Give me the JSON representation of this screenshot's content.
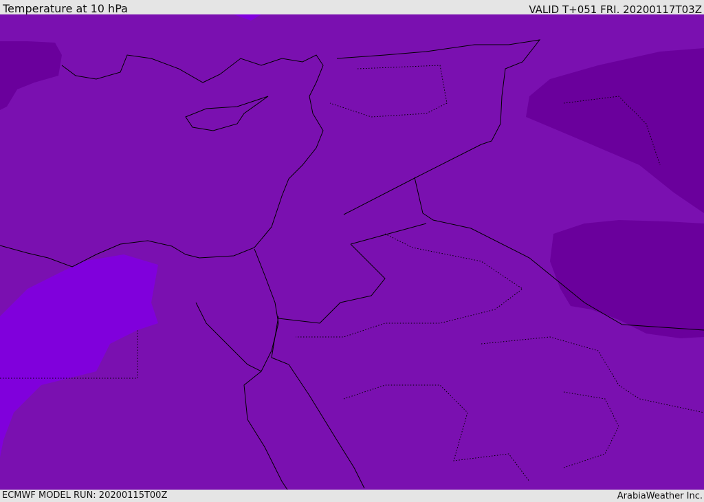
{
  "header": {
    "title": "Temperature at 10 hPa",
    "valid": "VALID T+051 FRI. 20200117T03Z"
  },
  "footer": {
    "model_run": "ECMWF MODEL RUN: 20200115T00Z",
    "credit": "ArabiaWeather Inc."
  },
  "colors": {
    "base": "#7a10b0",
    "cold": "#6a009c",
    "warm": "#8000dc",
    "line": "#000000",
    "bar": "#e5e5e5"
  }
}
